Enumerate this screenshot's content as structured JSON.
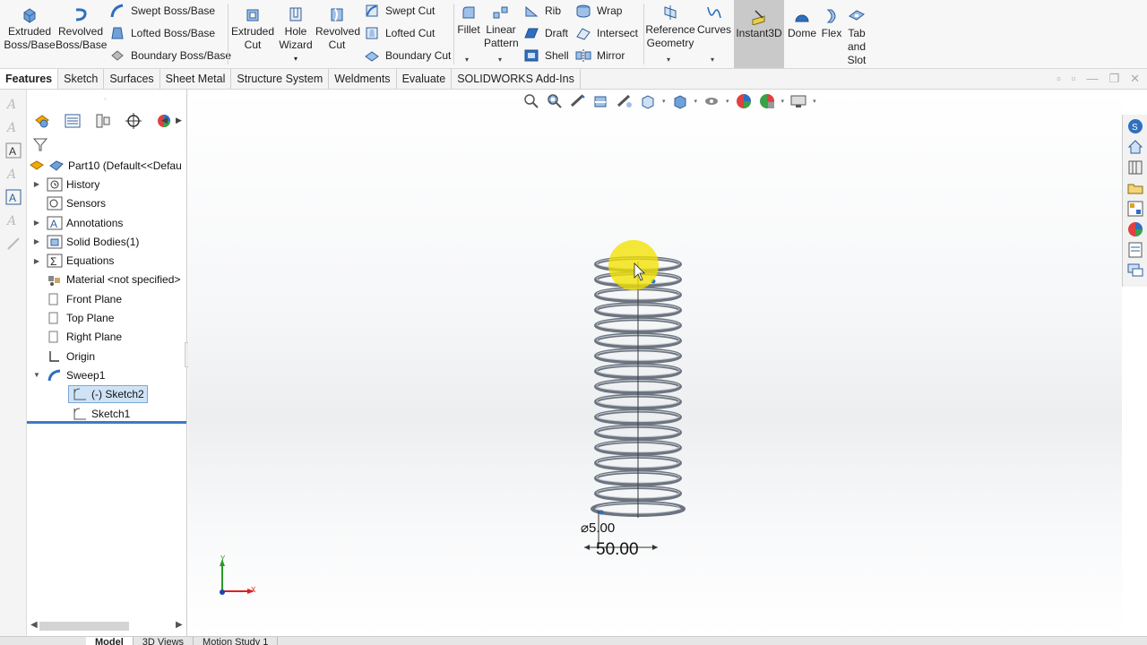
{
  "ribbon": {
    "extruded_boss": "Extruded Boss/Base",
    "revolved_boss": "Revolved Boss/Base",
    "swept_boss": "Swept Boss/Base",
    "lofted_boss": "Lofted Boss/Base",
    "boundary_boss": "Boundary Boss/Base",
    "extruded_cut": "Extruded Cut",
    "hole_wizard": "Hole Wizard",
    "revolved_cut": "Revolved Cut",
    "swept_cut": "Swept Cut",
    "lofted_cut": "Lofted Cut",
    "boundary_cut": "Boundary Cut",
    "fillet": "Fillet",
    "linear_pattern": "Linear Pattern",
    "rib": "Rib",
    "draft": "Draft",
    "shell": "Shell",
    "wrap": "Wrap",
    "intersect": "Intersect",
    "mirror": "Mirror",
    "reference_geometry": "Reference Geometry",
    "curves": "Curves",
    "instant3d": "Instant3D",
    "dome": "Dome",
    "flex": "Flex",
    "tab_and_slot": "Tab and Slot"
  },
  "tabs": [
    "Features",
    "Sketch",
    "Surfaces",
    "Sheet Metal",
    "Structure System",
    "Weldments",
    "Evaluate",
    "SOLIDWORKS Add-Ins"
  ],
  "tree": {
    "root": "Part10  (Default<<Defau",
    "items": [
      "History",
      "Sensors",
      "Annotations",
      "Solid Bodies(1)",
      "Equations",
      "Material <not specified>",
      "Front Plane",
      "Top Plane",
      "Right Plane",
      "Origin",
      "Sweep1",
      "(-) Sketch2",
      "Sketch1"
    ]
  },
  "viewport": {
    "dim_diameter": "⌀5.00",
    "dim_height": "50.00",
    "triad_y": "Y",
    "triad_x": "X"
  },
  "bottom_tabs": [
    "Model",
    "3D Views",
    "Motion Study 1"
  ],
  "colors": {
    "accent_blue": "#3a7bc8",
    "spring_gray": "#6c7480",
    "highlight_yellow": "#f2e200",
    "instant3d_bg": "#c9c9c9"
  }
}
